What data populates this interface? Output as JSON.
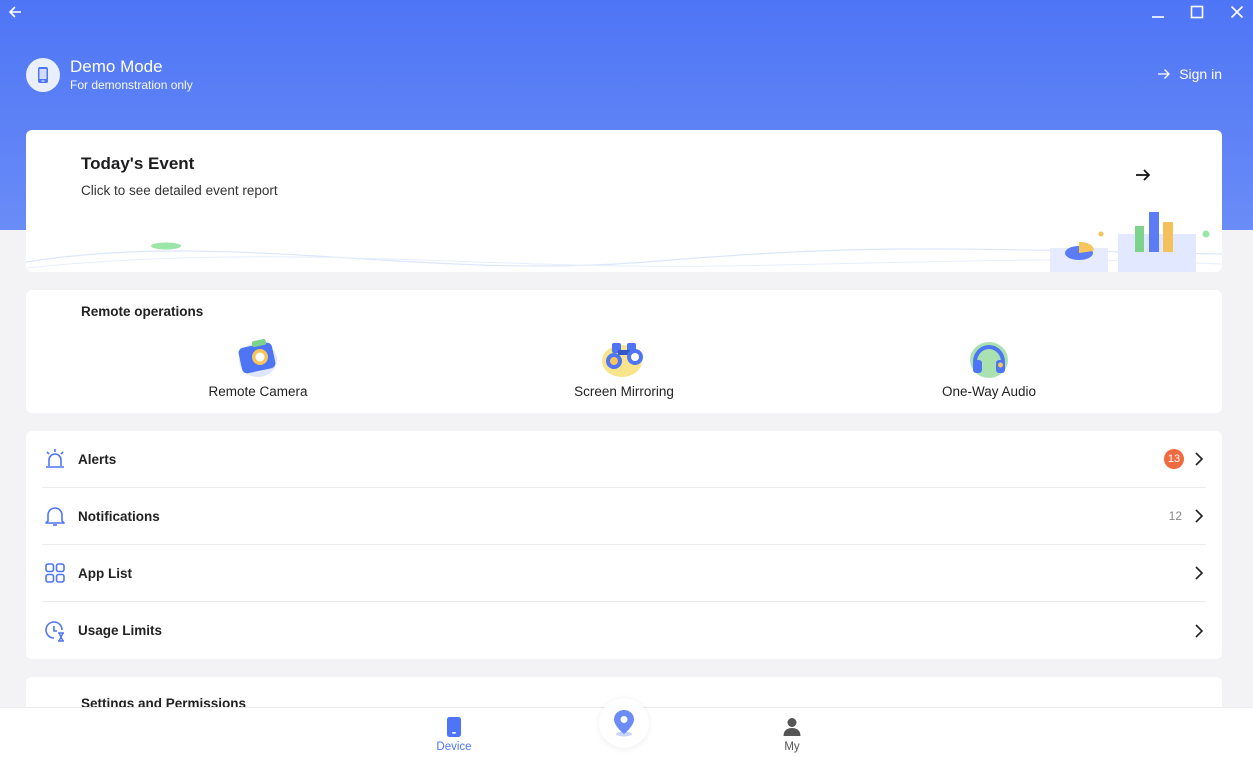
{
  "header": {
    "profile_name": "Demo Mode",
    "profile_sub": "For demonstration only",
    "signin_label": "Sign in"
  },
  "event": {
    "title": "Today's Event",
    "subtitle": "Click to see detailed event report"
  },
  "remote_operations": {
    "title": "Remote operations",
    "items": [
      {
        "label": "Remote Camera",
        "icon": "camera-icon"
      },
      {
        "label": "Screen Mirroring",
        "icon": "binoculars-icon"
      },
      {
        "label": "One-Way Audio",
        "icon": "headphones-icon"
      }
    ]
  },
  "list": {
    "alerts": {
      "label": "Alerts",
      "badge": "13",
      "icon": "alarm-icon"
    },
    "notifications": {
      "label": "Notifications",
      "count": "12",
      "icon": "bell-icon"
    },
    "app_list": {
      "label": "App List",
      "icon": "grid-icon"
    },
    "usage_limits": {
      "label": "Usage Limits",
      "icon": "clock-hourglass-icon"
    }
  },
  "settings": {
    "title": "Settings and Permissions"
  },
  "nav": {
    "device_label": "Device",
    "my_label": "My",
    "active_color": "#4e75f6",
    "inactive_color": "#555555"
  },
  "colors": {
    "brand": "#4e75f6",
    "badge": "#f06a3f"
  }
}
